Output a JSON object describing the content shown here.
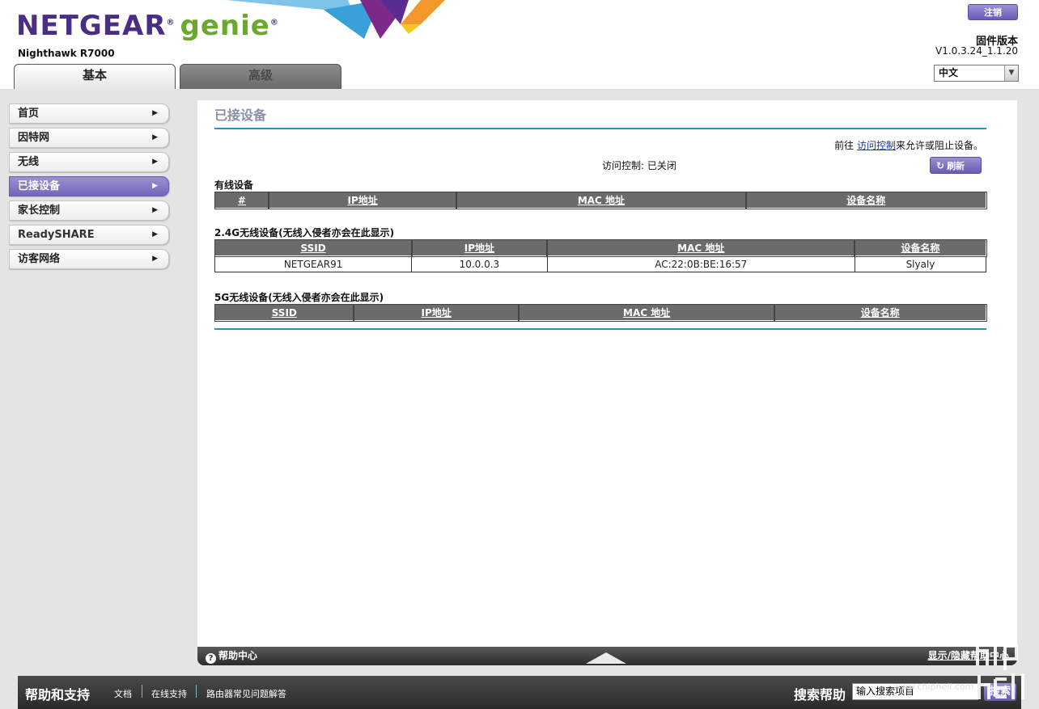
{
  "header": {
    "brand": "NETGEAR",
    "brand_sub": "genie",
    "model": "Nighthawk R7000",
    "tabs": [
      {
        "label": "基本",
        "active": true
      },
      {
        "label": "高级",
        "active": false
      }
    ],
    "logout_label": "注销",
    "firmware_title": "固件版本",
    "firmware_version": "V1.0.3.24_1.1.20",
    "language": "中文"
  },
  "sidebar": {
    "items": [
      {
        "label": "首页"
      },
      {
        "label": "因特网"
      },
      {
        "label": "无线"
      },
      {
        "label": "已接设备",
        "active": true
      },
      {
        "label": "家长控制"
      },
      {
        "label": "ReadySHARE"
      },
      {
        "label": "访客网络"
      }
    ]
  },
  "main": {
    "title": "已接设备",
    "access_note_prefix": "前往 ",
    "access_note_link": "访问控制",
    "access_note_suffix": "来允许或阻止设备。",
    "access_status": "访问控制: 已关闭",
    "refresh_label": "刷新",
    "wired": {
      "title": "有线设备",
      "headers": [
        "#",
        "IP地址",
        "MAC 地址",
        "设备名称"
      ]
    },
    "wifi24": {
      "title": "2.4G无线设备(无线入侵者亦会在此显示)",
      "headers": [
        "SSID",
        "IP地址",
        "MAC 地址",
        "设备名称"
      ],
      "rows": [
        [
          "NETGEAR91",
          "10.0.0.3",
          "AC:22:0B:BE:16:57",
          "Slyaly"
        ]
      ]
    },
    "wifi5": {
      "title": "5G无线设备(无线入侵者亦会在此显示)",
      "headers": [
        "SSID",
        "IP地址",
        "MAC 地址",
        "设备名称"
      ]
    }
  },
  "helpbar": {
    "label": "帮助中心",
    "toggle_label": "显示/隐藏帮助中心"
  },
  "footer": {
    "title": "帮助和支持",
    "links": [
      "文档",
      "在线支持",
      "路由器常见问题解答"
    ],
    "search_title": "搜索帮助",
    "search_placeholder": "输入搜索项目",
    "search_button": "搜索"
  },
  "watermark": {
    "text": "www.chiphell.com"
  },
  "colors": {
    "brand_purple": "#4b2e83",
    "brand_green": "#6aa82f",
    "accent_button": "#7566b9",
    "rule_blue": "#2a90b8",
    "table_header": "#6b6b6b"
  }
}
